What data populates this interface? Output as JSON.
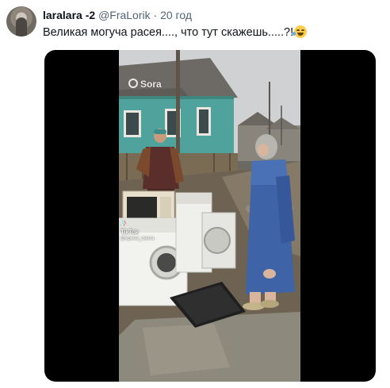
{
  "tweet": {
    "display_name": "laralara -2",
    "handle": "@FraLorik",
    "separator": "·",
    "time": "20 год",
    "text": "Великая могуча расея...., что тут скажешь.....?!",
    "emoji": "face-with-tears-of-joy"
  },
  "media": {
    "watermark_sora": "Sora",
    "tiktok_logo": "TikTok",
    "tiktok_user": "@ирина_смата",
    "colors": {
      "sky": "#cfd1d2",
      "house_wall": "#4fa39c",
      "roof": "#6d6a66",
      "mud": "#6e6353",
      "robe_blue": "#3e63a6"
    }
  }
}
